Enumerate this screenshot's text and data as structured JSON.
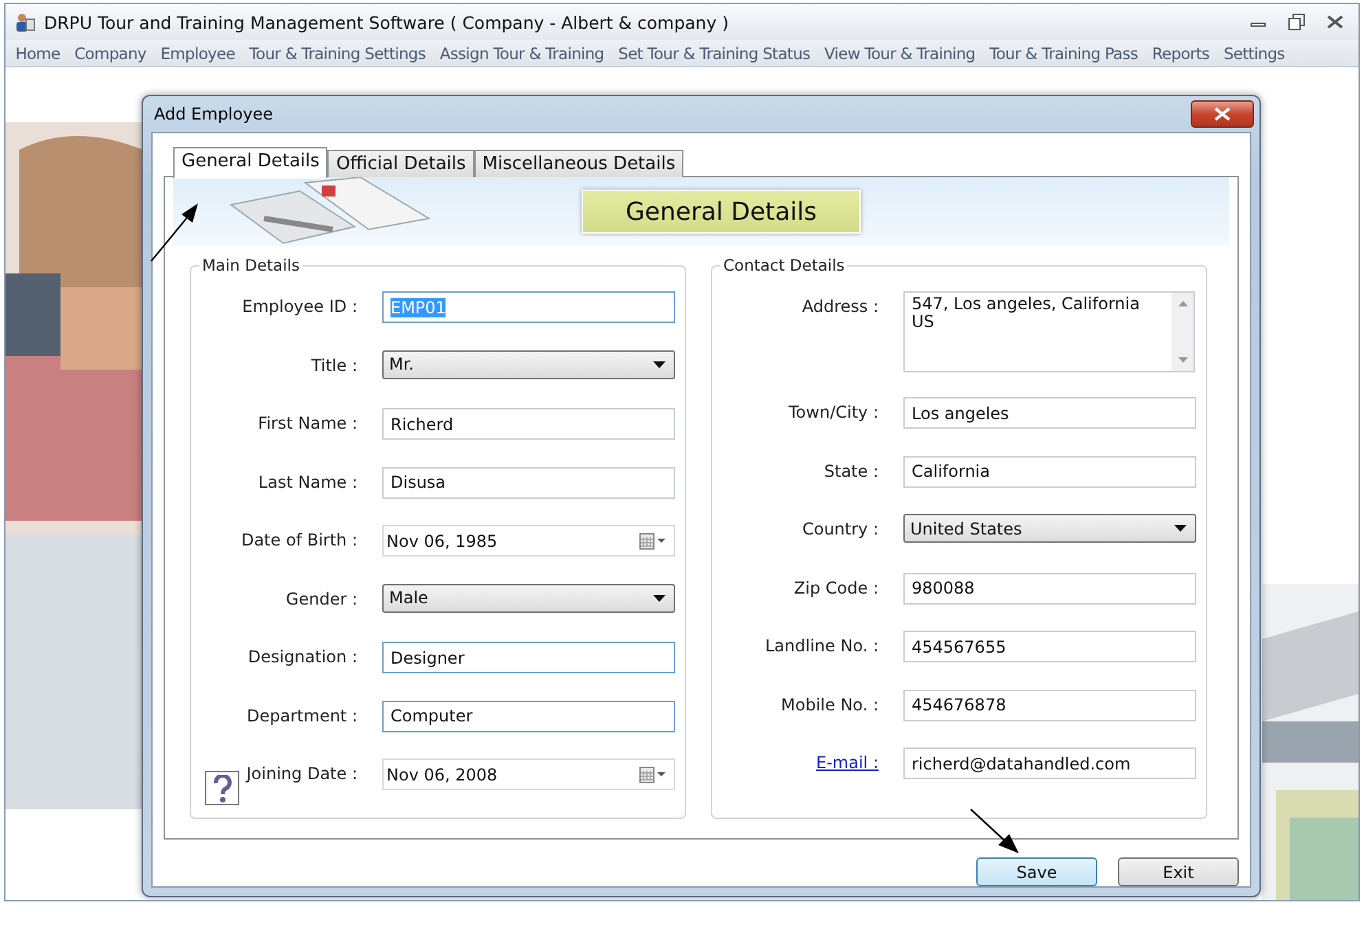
{
  "window": {
    "title": "DRPU Tour and Training Management Software ( Company - Albert & company )"
  },
  "menu": [
    "Home",
    "Company",
    "Employee",
    "Tour & Training Settings",
    "Assign Tour & Training",
    "Set Tour & Training Status",
    "View Tour & Training",
    "Tour & Training Pass",
    "Reports",
    "Settings"
  ],
  "dialog": {
    "title": "Add Employee",
    "tabs": [
      {
        "label": "General Details",
        "selected": true
      },
      {
        "label": "Official Details",
        "selected": false
      },
      {
        "label": "Miscellaneous Details",
        "selected": false
      }
    ],
    "banner_title": "General Details",
    "groups": [
      {
        "title": "Main Details",
        "fields": [
          {
            "kind": "text",
            "label": "Employee ID :",
            "value": "EMP01",
            "focused": true,
            "text_selected": true
          },
          {
            "kind": "select",
            "label": "Title :",
            "value": "Mr."
          },
          {
            "kind": "text",
            "label": "First Name :",
            "value": "Richerd",
            "focused": false,
            "text_selected": false
          },
          {
            "kind": "text",
            "label": "Last Name :",
            "value": "Disusa",
            "focused": false,
            "text_selected": false
          },
          {
            "kind": "date",
            "label": "Date of Birth :",
            "value": "Nov 06, 1985"
          },
          {
            "kind": "select",
            "label": "Gender :",
            "value": "Male"
          },
          {
            "kind": "text",
            "label": "Designation :",
            "value": "Designer",
            "focused": true,
            "text_selected": false
          },
          {
            "kind": "text",
            "label": "Department :",
            "value": "Computer",
            "focused": true,
            "text_selected": false
          },
          {
            "kind": "date",
            "label": "Joining Date :",
            "value": "Nov 06, 2008"
          }
        ]
      },
      {
        "title": "Contact Details",
        "fields": [
          {
            "kind": "textarea",
            "label": "Address :",
            "value": "547, Los angeles, California\nUS"
          },
          {
            "kind": "text",
            "label": "Town/City :",
            "value": "Los angeles",
            "focused": false,
            "text_selected": false
          },
          {
            "kind": "text",
            "label": "State :",
            "value": "California",
            "focused": false,
            "text_selected": false
          },
          {
            "kind": "select",
            "label": "Country :",
            "value": "United States"
          },
          {
            "kind": "text",
            "label": "Zip Code :",
            "value": "980088",
            "focused": false,
            "text_selected": false
          },
          {
            "kind": "text",
            "label": "Landline No. :",
            "value": "454567655",
            "focused": false,
            "text_selected": false
          },
          {
            "kind": "text",
            "label": "Mobile No. :",
            "value": "454676878",
            "focused": false,
            "text_selected": false
          },
          {
            "kind": "link",
            "label": "E-mail :",
            "value": "richerd@datahandled.com",
            "focused": false,
            "text_selected": false
          }
        ]
      }
    ],
    "buttons": [
      {
        "label": "Save",
        "focused": true
      },
      {
        "label": "Exit",
        "focused": false
      }
    ]
  }
}
